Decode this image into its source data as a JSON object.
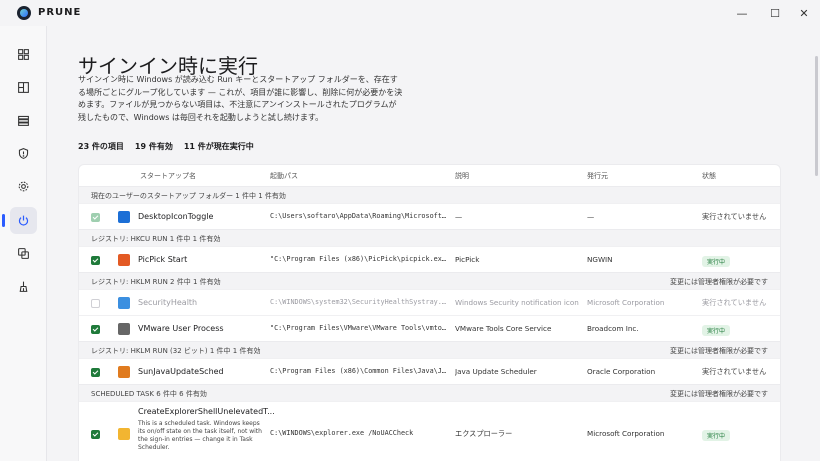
{
  "app": {
    "title": "PRUNE"
  },
  "window_controls": {
    "minimize": "—",
    "maximize": "☐",
    "close": "✕"
  },
  "sidebar": {
    "items": [
      {
        "icon": "dashboard-icon"
      },
      {
        "icon": "apps-icon"
      },
      {
        "icon": "storage-icon"
      },
      {
        "icon": "shield-icon"
      },
      {
        "icon": "gear-icon"
      },
      {
        "icon": "power-icon",
        "active": true
      },
      {
        "icon": "copy-icon"
      },
      {
        "icon": "broom-icon"
      }
    ]
  },
  "page": {
    "title": "サインイン時に実行",
    "description": "サインイン時に Windows が読み込む Run キーとスタートアップ フォルダーを、存在する場所ごとにグループ化しています — これが、項目が誰に影響し、削除に何が必要かを決めます。ファイルが見つからない項目は、不注意にアンインストールされたプログラムが残したもので、Windows は毎回それを起動しようと試し続けます。",
    "summary": {
      "total": "23 件の項目",
      "enabled": "19 件有効",
      "running": "11 件が現在実行中"
    }
  },
  "table": {
    "headers": {
      "name": "スタートアップ名",
      "path": "起動パス",
      "description": "説明",
      "publisher": "発行元",
      "status": "状態"
    },
    "groups": [
      {
        "label": "現在のユーザーのスタートアップ フォルダー 1 件中 1 件有効",
        "right": "",
        "rows": [
          {
            "checked": "muted",
            "name": "DesktopIconToggle",
            "path": "C:\\Users\\softaro\\AppData\\Roaming\\Microsoft\\Windows\\Start Menu",
            "description": "—",
            "publisher": "—",
            "status": "実行されていません",
            "badge": false,
            "icon": "desktop-app-icon",
            "color": "#1c6fd6"
          }
        ]
      },
      {
        "label": "レジストリ: HKCU RUN 1 件中 1 件有効",
        "right": "",
        "rows": [
          {
            "checked": "on",
            "name": "PicPick Start",
            "path": "\"C:\\Program Files (x86)\\PicPick\\picpick.exe\" /startup",
            "description": "PicPick",
            "publisher": "NGWIN",
            "status": "実行中",
            "badge": true,
            "icon": "picpick-icon",
            "color": "#e35a24"
          }
        ]
      },
      {
        "label": "レジストリ: HKLM RUN 2 件中 1 件有効",
        "right": "変更には管理者権限が必要です",
        "rows": [
          {
            "checked": "off",
            "name": "SecurityHealth",
            "path": "C:\\WINDOWS\\system32\\SecurityHealthSystray.exe",
            "description": "Windows Security notification icon",
            "publisher": "Microsoft Corporation",
            "status": "実行されていません",
            "badge": false,
            "disabled": true,
            "icon": "security-shield-icon",
            "color": "#3b8fe0"
          },
          {
            "checked": "on",
            "name": "VMware User Process",
            "path": "\"C:\\Program Files\\VMware\\VMware Tools\\vmtoolsd.exe\" -n vmusr",
            "description": "VMware Tools Core Service",
            "publisher": "Broadcom Inc.",
            "status": "実行中",
            "badge": true,
            "icon": "vmware-icon",
            "color": "#666"
          }
        ]
      },
      {
        "label": "レジストリ: HKLM RUN (32 ビット) 1 件中 1 件有効",
        "right": "変更には管理者権限が必要です",
        "rows": [
          {
            "checked": "on",
            "name": "SunJavaUpdateSched",
            "path": "C:\\Program Files (x86)\\Common Files\\Java\\Java Update\\jusched.exe",
            "description": "Java Update Scheduler",
            "publisher": "Oracle Corporation",
            "status": "実行されていません",
            "badge": false,
            "icon": "java-icon",
            "color": "#e07b1f"
          }
        ]
      },
      {
        "label": "SCHEDULED TASK 6 件中 6 件有効",
        "right": "変更には管理者権限が必要です",
        "rows": [
          {
            "checked": "on",
            "name": "CreateExplorerShellUnelevatedT...",
            "sub": "This is a scheduled task. Windows keeps its on/off state on the task itself, not with the sign-in entries — change it in Task Scheduler.",
            "path": "C:\\WINDOWS\\explorer.exe /NoUACCheck",
            "description": "エクスプローラー",
            "publisher": "Microsoft Corporation",
            "status": "実行中",
            "badge": true,
            "icon": "folder-icon",
            "color": "#f2b531"
          }
        ]
      }
    ]
  }
}
